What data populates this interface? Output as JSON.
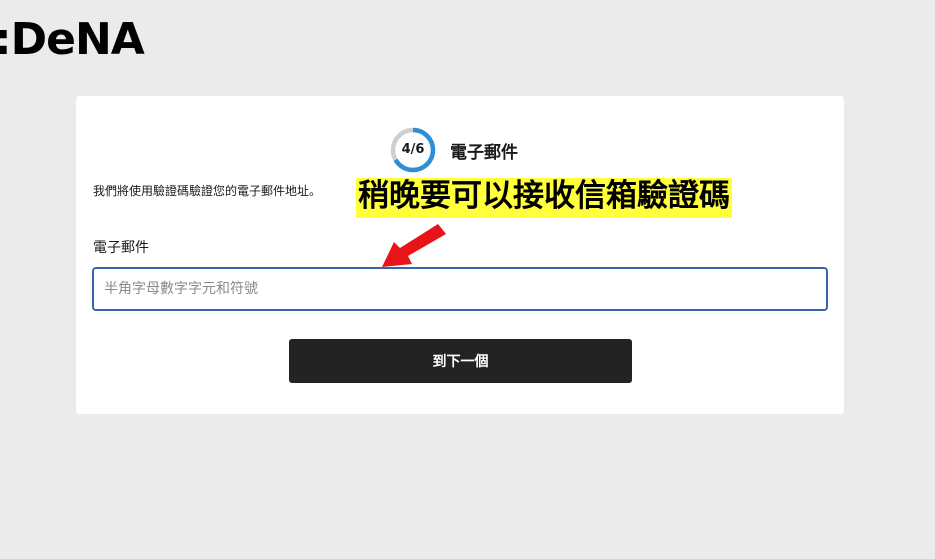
{
  "header": {
    "logo_text": ":DeNA"
  },
  "form": {
    "step_progress": "4/6",
    "step_fraction": 0.667,
    "step_title": "電子郵件",
    "description": "我們將使用驗證碼驗證您的電子郵件地址。",
    "field_label": "電子郵件",
    "input_placeholder": "半角字母數字字元和符號",
    "input_value": "",
    "next_button_label": "到下一個"
  },
  "annotation": {
    "text": "稍晚要可以接收信箱驗證碼",
    "highlight_color": "#ffff3c",
    "arrow_color": "#e8141a"
  },
  "colors": {
    "progress_active": "#2a8fd6",
    "progress_track": "#cfcfcf",
    "input_border": "#3a64a8",
    "button_bg": "#232323"
  }
}
